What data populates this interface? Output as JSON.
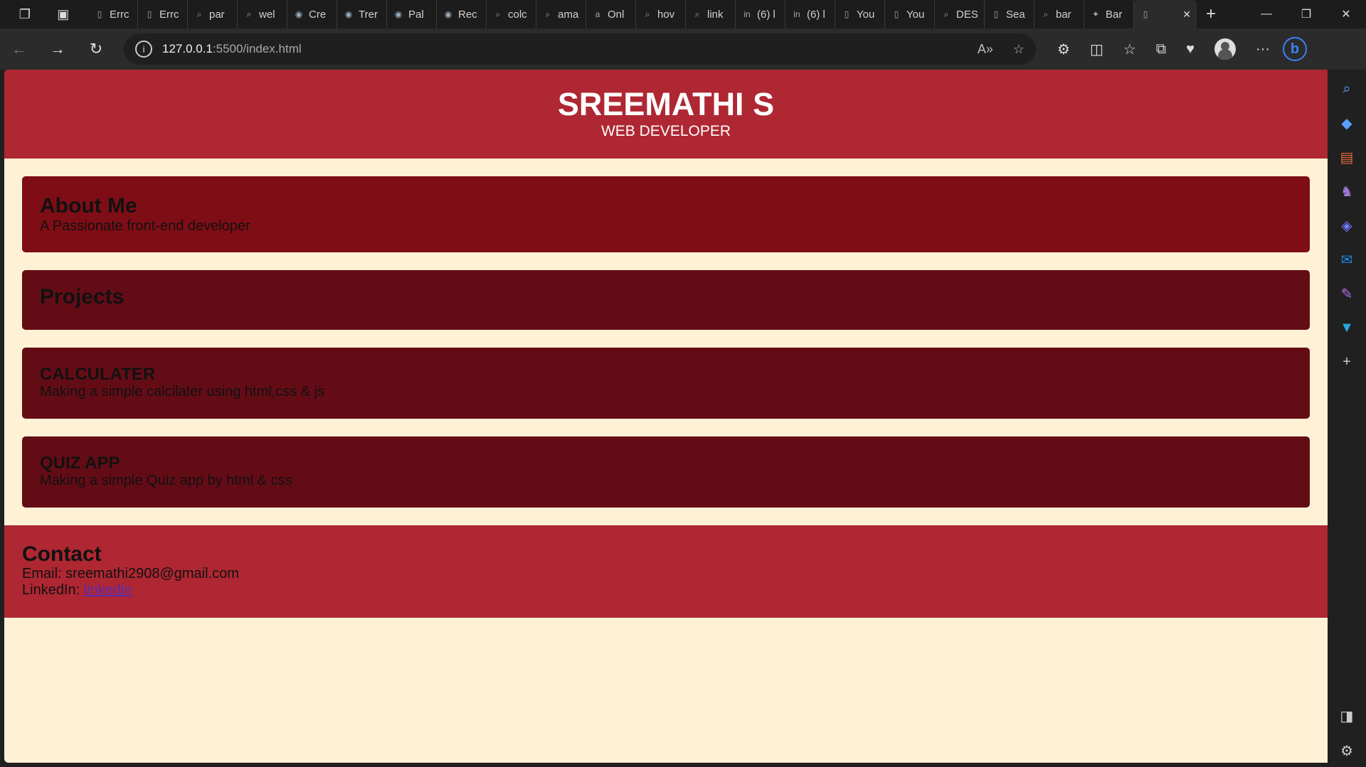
{
  "browser": {
    "tabs": [
      {
        "label": "Errc",
        "icon": "page-icon"
      },
      {
        "label": "Errc",
        "icon": "page-icon"
      },
      {
        "label": "par",
        "icon": "search-icon"
      },
      {
        "label": "wel",
        "icon": "search-icon"
      },
      {
        "label": "Cre",
        "icon": "chat-icon"
      },
      {
        "label": "Trer",
        "icon": "chat-icon"
      },
      {
        "label": "Pal",
        "icon": "chat-icon"
      },
      {
        "label": "Rec",
        "icon": "chat-icon"
      },
      {
        "label": "colc",
        "icon": "search-icon"
      },
      {
        "label": "ama",
        "icon": "search-icon"
      },
      {
        "label": "Onl",
        "icon": "amazon-icon"
      },
      {
        "label": "hov",
        "icon": "search-icon"
      },
      {
        "label": "link",
        "icon": "search-icon"
      },
      {
        "label": "(6) l",
        "icon": "linkedin-icon"
      },
      {
        "label": "(6) l",
        "icon": "linkedin-icon"
      },
      {
        "label": "You",
        "icon": "page-icon"
      },
      {
        "label": "You",
        "icon": "page-icon"
      },
      {
        "label": "DES",
        "icon": "search-icon"
      },
      {
        "label": "Sea",
        "icon": "page-icon"
      },
      {
        "label": "bar",
        "icon": "search-icon"
      },
      {
        "label": "Bar",
        "icon": "sparkle-icon"
      }
    ],
    "active_tab_label": "",
    "url_host": "127.0.0.1",
    "url_path": ":5500/index.html"
  },
  "page": {
    "header": {
      "name": "SREEMATHI S",
      "role": "WEB DEVELOPER"
    },
    "about": {
      "title": "About Me",
      "text": "A Passionate front-end developer"
    },
    "projects": {
      "title": "Projects",
      "items": [
        {
          "title": "CALCULATER",
          "text": "Making a simple calcilater using html,css & js"
        },
        {
          "title": "QUIZ APP",
          "text": "Making a simple Quiz app by html & css"
        }
      ]
    },
    "contact": {
      "title": "Contact",
      "email_label": "Email:",
      "email": "sreemathi2908@gmail.com",
      "linkedin_label": "LinkedIn:",
      "linkedin_link": "linkedin"
    }
  },
  "colors": {
    "header_bg": "#ae2732",
    "card_bg": "#640c16",
    "about_bg": "#7f0d15",
    "page_bg": "#fff1d5"
  }
}
